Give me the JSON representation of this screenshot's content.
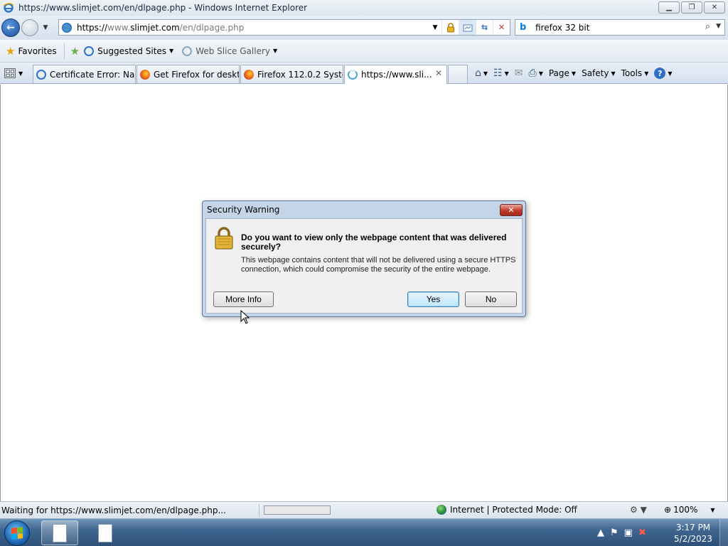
{
  "window": {
    "title": "https://www.slimjet.com/en/dlpage.php - Windows Internet Explorer",
    "minimize_icon": "minimize-icon",
    "restore_icon": "restore-icon",
    "close_icon": "close-icon"
  },
  "address_bar": {
    "prefix": "https://",
    "host_dim": "www.",
    "host": "slimjet.com",
    "path_dim": "/en/dlpage.php",
    "icons": [
      "security-lock-icon",
      "compatibility-view-icon",
      "refresh-icon",
      "stop-icon"
    ]
  },
  "search": {
    "value": "firefox 32 bit",
    "provider_icon": "bing-icon"
  },
  "favorites_bar": {
    "favorites_label": "Favorites",
    "suggested_sites_label": "Suggested Sites",
    "web_slice_label": "Web Slice Gallery"
  },
  "tabs": [
    {
      "label": "Certificate Error: Na...",
      "icon": "ie-icon",
      "active": false
    },
    {
      "label": "Get Firefox for deskt...",
      "icon": "firefox-icon",
      "active": false
    },
    {
      "label": "Firefox 112.0.2 Syste...",
      "icon": "firefox-icon",
      "active": false
    },
    {
      "label": "https://www.sli...",
      "icon": "loading-icon",
      "active": true
    }
  ],
  "command_bar": {
    "page_label": "Page",
    "safety_label": "Safety",
    "tools_label": "Tools",
    "help_glyph": "?"
  },
  "dialog": {
    "title": "Security Warning",
    "question": "Do you want to view only the webpage content that was delivered securely?",
    "detail": "This webpage contains content that will not be delivered using a secure HTTPS connection, which could compromise the security of the entire webpage.",
    "more_info_label": "More Info",
    "yes_label": "Yes",
    "no_label": "No",
    "icon": "padlock-icon"
  },
  "status_bar": {
    "text": "Waiting for https://www.slimjet.com/en/dlpage.php...",
    "progress": 0.0,
    "zone": "Internet | Protected Mode: Off",
    "zoom": "100%"
  },
  "taskbar": {
    "time": "3:17 PM",
    "date": "5/2/2023"
  }
}
